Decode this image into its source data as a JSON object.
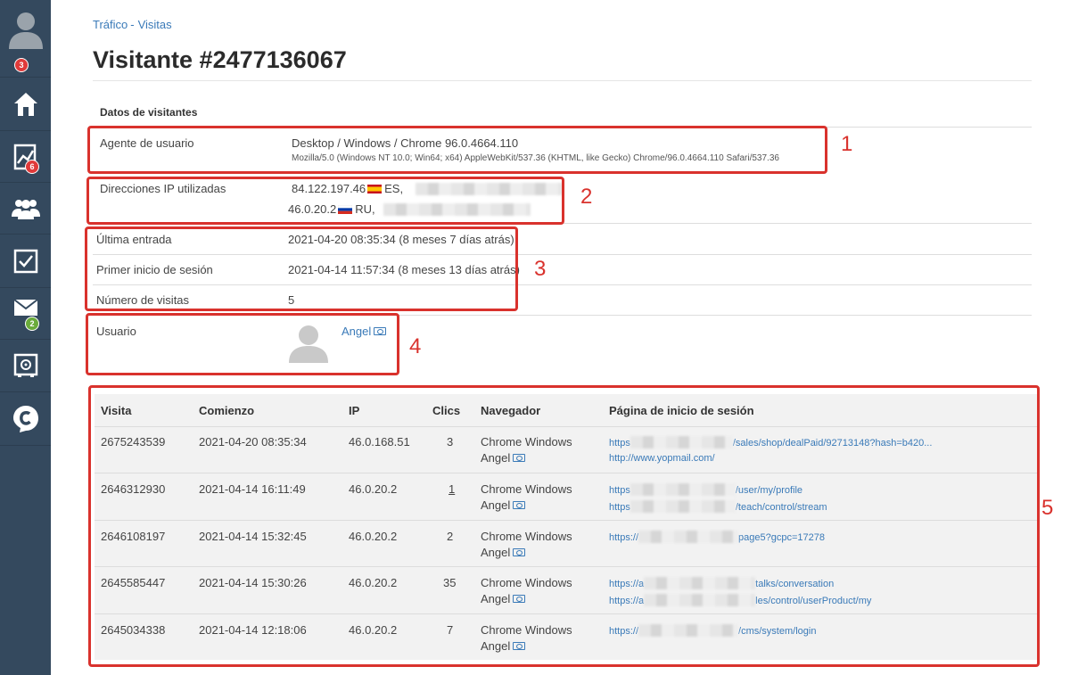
{
  "sidebar": {
    "avatar_badge": "3",
    "traffic_badge": "6",
    "mail_badge": "2",
    "items": [
      "avatar-icon",
      "home-icon",
      "chart-icon",
      "users-icon",
      "checkbox-icon",
      "mail-icon",
      "safe-icon",
      "logo-icon"
    ]
  },
  "breadcrumb": {
    "item1": "Tráfico",
    "sep": "-",
    "item2": "Visitas"
  },
  "page": {
    "title": "Visitante #2477136067"
  },
  "visitor": {
    "section_title": "Datos de visitantes",
    "user_agent_label": "Agente de usuario",
    "user_agent_value": "Desktop / Windows / Chrome 96.0.4664.110",
    "user_agent_full": "Mozilla/5.0 (Windows NT 10.0; Win64; x64) AppleWebKit/537.36 (KHTML, like Gecko) Chrome/96.0.4664.110 Safari/537.36",
    "ip_label": "Direcciones IP utilizadas",
    "ip1": "84.122.197.46",
    "ip1_country": "ES,",
    "ip2": "46.0.20.2",
    "ip2_country": "RU,",
    "last_entry_label": "Última entrada",
    "last_entry_value": "2021-04-20 08:35:34 (8 meses 7 días atrás)",
    "first_login_label": "Primer inicio de sesión",
    "first_login_value": "2021-04-14 11:57:34 (8 meses 13 días atrás)",
    "visits_label": "Número de visitas",
    "visits_value": "5",
    "user_label": "Usuario",
    "user_name": "Angel"
  },
  "annotations": [
    "1",
    "2",
    "3",
    "4",
    "5"
  ],
  "table": {
    "headers": [
      "Visita",
      "Comienzo",
      "IP",
      "Clics",
      "Navegador",
      "Página de inicio de sesión"
    ],
    "rows": [
      {
        "visit": "2675243539",
        "start": "2021-04-20 08:35:34",
        "ip": "46.0.168.51",
        "clicks": "3",
        "browser": "Chrome Windows",
        "user": "Angel",
        "page1_a": "https",
        "page1_b": "/sales/shop/dealPaid/92713148?hash=b420...",
        "page2_a": "http://www.yopmail.com/",
        "page2_b": ""
      },
      {
        "visit": "2646312930",
        "start": "2021-04-14 16:11:49",
        "ip": "46.0.20.2",
        "clicks": "1",
        "browser": "Chrome Windows",
        "user": "Angel",
        "page1_a": "https",
        "page1_b": "/user/my/profile",
        "page2_a": "https",
        "page2_b": "/teach/control/stream"
      },
      {
        "visit": "2646108197",
        "start": "2021-04-14 15:32:45",
        "ip": "46.0.20.2",
        "clicks": "2",
        "browser": "Chrome Windows",
        "user": "Angel",
        "page1_a": "https://",
        "page1_b": "page5?gcpc=17278",
        "page2_a": "",
        "page2_b": ""
      },
      {
        "visit": "2645585447",
        "start": "2021-04-14 15:30:26",
        "ip": "46.0.20.2",
        "clicks": "35",
        "browser": "Chrome Windows",
        "user": "Angel",
        "page1_a": "https://a",
        "page1_b": "talks/conversation",
        "page2_a": "https://a",
        "page2_b": "les/control/userProduct/my"
      },
      {
        "visit": "2645034338",
        "start": "2021-04-14 12:18:06",
        "ip": "46.0.20.2",
        "clicks": "7",
        "browser": "Chrome Windows",
        "user": "Angel",
        "page1_a": "https://",
        "page1_b": "/cms/system/login",
        "page2_a": "",
        "page2_b": ""
      }
    ]
  }
}
